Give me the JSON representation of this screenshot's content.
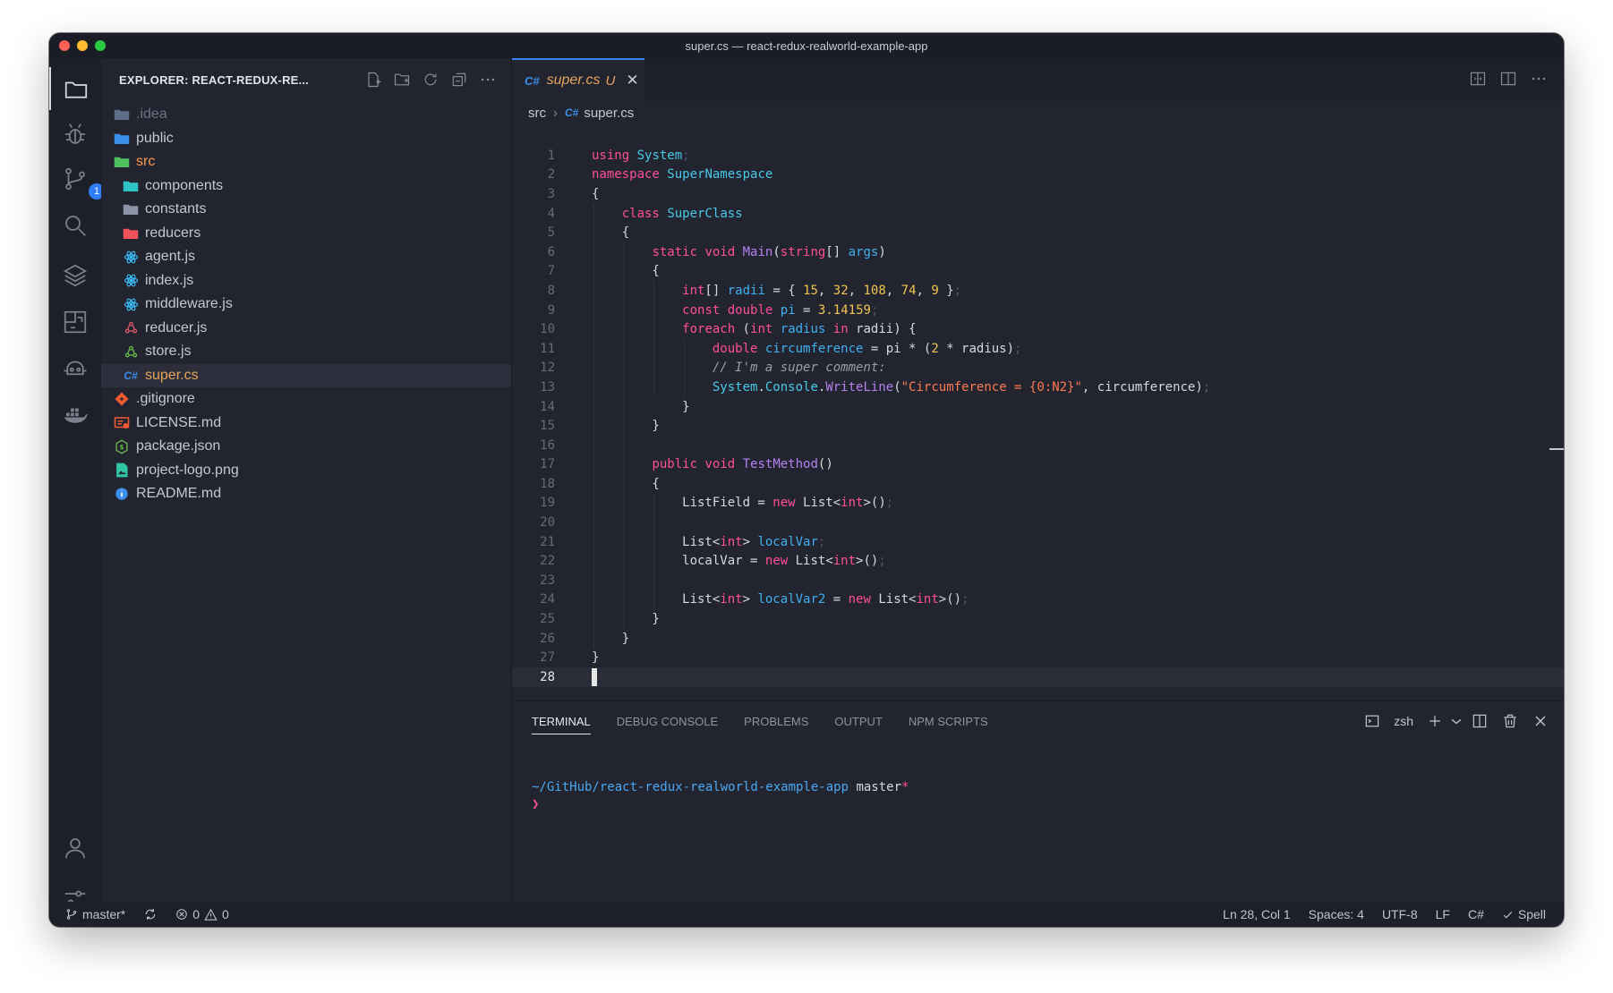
{
  "window": {
    "title": "super.cs — react-redux-realworld-example-app"
  },
  "activity_bar": {
    "source_control_badge": "1"
  },
  "explorer": {
    "title": "EXPLORER: REACT-REDUX-RE...",
    "items": [
      {
        "label": ".idea",
        "level": 0,
        "icon": "folder-idea-icon",
        "color": "#5f6f8a",
        "dim": true
      },
      {
        "label": "public",
        "level": 0,
        "icon": "folder-public-icon",
        "color": "#3b8eea"
      },
      {
        "label": "src",
        "level": 0,
        "icon": "folder-src-icon",
        "color": "#4fc05f",
        "accent": "#ff9a4a"
      },
      {
        "label": "components",
        "level": 1,
        "icon": "folder-components-icon",
        "color": "#2fc4c4"
      },
      {
        "label": "constants",
        "level": 1,
        "icon": "folder-constants-icon",
        "color": "#8b93a6"
      },
      {
        "label": "reducers",
        "level": 1,
        "icon": "folder-reducers-icon",
        "color": "#f0525a"
      },
      {
        "label": "agent.js",
        "level": 1,
        "icon": "react-icon",
        "color": "#38bdf8"
      },
      {
        "label": "index.js",
        "level": 1,
        "icon": "react-icon",
        "color": "#38bdf8"
      },
      {
        "label": "middleware.js",
        "level": 1,
        "icon": "react-icon",
        "color": "#38bdf8"
      },
      {
        "label": "reducer.js",
        "level": 1,
        "icon": "redux-icon",
        "color": "#e25b6a"
      },
      {
        "label": "store.js",
        "level": 1,
        "icon": "redux-store-icon",
        "color": "#6bbf4a"
      },
      {
        "label": "super.cs",
        "level": 1,
        "icon": "csharp-icon",
        "color": "#3b8eea",
        "selected": true,
        "accent": "#e8a35a"
      },
      {
        "label": ".gitignore",
        "level": 0,
        "icon": "git-icon",
        "color": "#f05a33"
      },
      {
        "label": "LICENSE.md",
        "level": 0,
        "icon": "license-icon",
        "color": "#f05a33"
      },
      {
        "label": "package.json",
        "level": 0,
        "icon": "nodejs-icon",
        "color": "#6bbf4a"
      },
      {
        "label": "project-logo.png",
        "level": 0,
        "icon": "image-icon",
        "color": "#2fc4a4"
      },
      {
        "label": "README.md",
        "level": 0,
        "icon": "info-icon",
        "color": "#3b8eea"
      }
    ]
  },
  "tab": {
    "lang": "C#",
    "name": "super.cs",
    "status": "U",
    "close": "✕"
  },
  "breadcrumb": {
    "folder": "src",
    "lang": "C#",
    "file": "super.cs"
  },
  "code": {
    "current_line": 28,
    "lines": [
      [
        [
          "k",
          "using"
        ],
        [
          "x",
          " "
        ],
        [
          "t",
          "System"
        ],
        [
          "p",
          ";"
        ]
      ],
      [
        [
          "k",
          "namespace"
        ],
        [
          "x",
          " "
        ],
        [
          "t",
          "SuperNamespace"
        ]
      ],
      [
        [
          "x",
          "{"
        ]
      ],
      [
        [
          "x",
          "    "
        ],
        [
          "k",
          "class"
        ],
        [
          "x",
          " "
        ],
        [
          "t",
          "SuperClass"
        ]
      ],
      [
        [
          "x",
          "    {"
        ]
      ],
      [
        [
          "x",
          "        "
        ],
        [
          "k",
          "static"
        ],
        [
          "x",
          " "
        ],
        [
          "k",
          "void"
        ],
        [
          "x",
          " "
        ],
        [
          "f",
          "Main"
        ],
        [
          "x",
          "("
        ],
        [
          "k",
          "string"
        ],
        [
          "x",
          "[] "
        ],
        [
          "v",
          "args"
        ],
        [
          "x",
          ")"
        ]
      ],
      [
        [
          "x",
          "        {"
        ]
      ],
      [
        [
          "x",
          "            "
        ],
        [
          "k",
          "int"
        ],
        [
          "x",
          "[] "
        ],
        [
          "v",
          "radii"
        ],
        [
          "x",
          " = { "
        ],
        [
          "n",
          "15"
        ],
        [
          "x",
          ", "
        ],
        [
          "n",
          "32"
        ],
        [
          "x",
          ", "
        ],
        [
          "n",
          "108"
        ],
        [
          "x",
          ", "
        ],
        [
          "n",
          "74"
        ],
        [
          "x",
          ", "
        ],
        [
          "n",
          "9"
        ],
        [
          "x",
          " }"
        ],
        [
          "p",
          ";"
        ]
      ],
      [
        [
          "x",
          "            "
        ],
        [
          "k",
          "const"
        ],
        [
          "x",
          " "
        ],
        [
          "k",
          "double"
        ],
        [
          "x",
          " "
        ],
        [
          "v",
          "pi"
        ],
        [
          "x",
          " = "
        ],
        [
          "n",
          "3.14159"
        ],
        [
          "p",
          ";"
        ]
      ],
      [
        [
          "x",
          "            "
        ],
        [
          "k",
          "foreach"
        ],
        [
          "x",
          " ("
        ],
        [
          "k",
          "int"
        ],
        [
          "x",
          " "
        ],
        [
          "v",
          "radius"
        ],
        [
          "x",
          " "
        ],
        [
          "k",
          "in"
        ],
        [
          "x",
          " radii) {"
        ]
      ],
      [
        [
          "x",
          "                "
        ],
        [
          "k",
          "double"
        ],
        [
          "x",
          " "
        ],
        [
          "v",
          "circumference"
        ],
        [
          "x",
          " = pi * ("
        ],
        [
          "n",
          "2"
        ],
        [
          "x",
          " * radius)"
        ],
        [
          "p",
          ";"
        ]
      ],
      [
        [
          "x",
          "                "
        ],
        [
          "c",
          "// I'm a super comment:"
        ]
      ],
      [
        [
          "x",
          "                "
        ],
        [
          "t",
          "System"
        ],
        [
          "x",
          "."
        ],
        [
          "t",
          "Console"
        ],
        [
          "x",
          "."
        ],
        [
          "f",
          "WriteLine"
        ],
        [
          "x",
          "("
        ],
        [
          "s",
          "\"Circumference = {0:N2}\""
        ],
        [
          "x",
          ", circumference)"
        ],
        [
          "p",
          ";"
        ]
      ],
      [
        [
          "x",
          "            }"
        ]
      ],
      [
        [
          "x",
          "        }"
        ]
      ],
      [
        [
          "x",
          ""
        ]
      ],
      [
        [
          "x",
          "        "
        ],
        [
          "k",
          "public"
        ],
        [
          "x",
          " "
        ],
        [
          "k",
          "void"
        ],
        [
          "x",
          " "
        ],
        [
          "f",
          "TestMethod"
        ],
        [
          "x",
          "()"
        ]
      ],
      [
        [
          "x",
          "        {"
        ]
      ],
      [
        [
          "x",
          "            ListField = "
        ],
        [
          "k",
          "new"
        ],
        [
          "x",
          " List<"
        ],
        [
          "k",
          "int"
        ],
        [
          "x",
          ">()"
        ],
        [
          "p",
          ";"
        ]
      ],
      [
        [
          "x",
          ""
        ]
      ],
      [
        [
          "x",
          "            List<"
        ],
        [
          "k",
          "int"
        ],
        [
          "x",
          "> "
        ],
        [
          "v",
          "localVar"
        ],
        [
          "p",
          ";"
        ]
      ],
      [
        [
          "x",
          "            localVar = "
        ],
        [
          "k",
          "new"
        ],
        [
          "x",
          " List<"
        ],
        [
          "k",
          "int"
        ],
        [
          "x",
          ">()"
        ],
        [
          "p",
          ";"
        ]
      ],
      [
        [
          "x",
          ""
        ]
      ],
      [
        [
          "x",
          "            List<"
        ],
        [
          "k",
          "int"
        ],
        [
          "x",
          "> "
        ],
        [
          "v",
          "localVar2"
        ],
        [
          "x",
          " = "
        ],
        [
          "k",
          "new"
        ],
        [
          "x",
          " List<"
        ],
        [
          "k",
          "int"
        ],
        [
          "x",
          ">()"
        ],
        [
          "p",
          ";"
        ]
      ],
      [
        [
          "x",
          "        }"
        ]
      ],
      [
        [
          "x",
          "    }"
        ]
      ],
      [
        [
          "x",
          "}"
        ]
      ],
      [
        [
          "x",
          ""
        ]
      ]
    ]
  },
  "panel": {
    "tabs": [
      "TERMINAL",
      "DEBUG CONSOLE",
      "PROBLEMS",
      "OUTPUT",
      "NPM SCRIPTS"
    ],
    "active_tab": "TERMINAL",
    "shell": "zsh",
    "terminal": {
      "path": "~/GitHub/react-redux-realworld-example-app",
      "branch": "master",
      "dirty": "*",
      "prompt": "❯"
    }
  },
  "statusbar": {
    "branch": "master*",
    "errors": "0",
    "warnings": "0",
    "position": "Ln 28, Col 1",
    "spaces": "Spaces: 4",
    "encoding": "UTF-8",
    "eol": "LF",
    "language": "C#",
    "spell": "Spell"
  }
}
